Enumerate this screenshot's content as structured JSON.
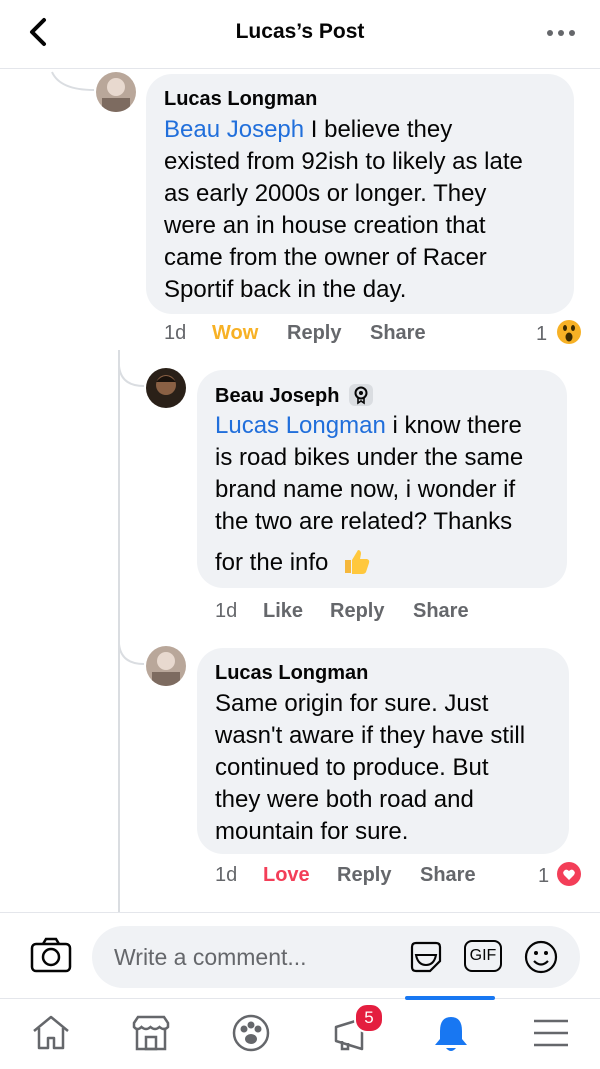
{
  "header": {
    "title": "Lucas’s Post"
  },
  "comments": [
    {
      "author": "Lucas Longman",
      "mention": "Beau Joseph",
      "lines": [
        " I believe they",
        "existed from 92ish to likely as late",
        "as early 2000s or longer. They",
        "were an in house creation that",
        "came from the owner of Racer",
        "Sportif back in the day."
      ],
      "time": "1d",
      "reaction_label": "Wow",
      "reply": "Reply",
      "share": "Share",
      "reaction_count": "1",
      "reaction_icon": "wow-icon"
    },
    {
      "author": "Beau Joseph",
      "mention": "Lucas Longman",
      "lines": [
        " i know there",
        "is road bikes under the same",
        "brand name now, i wonder if",
        "the two are related? Thanks",
        "for the info"
      ],
      "time": "1d",
      "reaction_label": "Like",
      "reply": "Reply",
      "share": "Share"
    },
    {
      "author": "Lucas Longman",
      "lines": [
        "Same origin for sure. Just",
        "wasn't aware if they have still",
        "continued to produce. But",
        "they were both road and",
        "mountain for sure."
      ],
      "time": "1d",
      "reaction_label": "Love",
      "reply": "Reply",
      "share": "Share",
      "reaction_count": "1",
      "reaction_icon": "love-icon"
    }
  ],
  "composer": {
    "placeholder": "Write a comment...",
    "gif_label": "GIF"
  },
  "tabbar": {
    "notifications_badge": "5"
  },
  "colors": {
    "accent": "#1877f2",
    "wow": "#f7b125",
    "love": "#f33e58",
    "mention": "#216fdb"
  }
}
